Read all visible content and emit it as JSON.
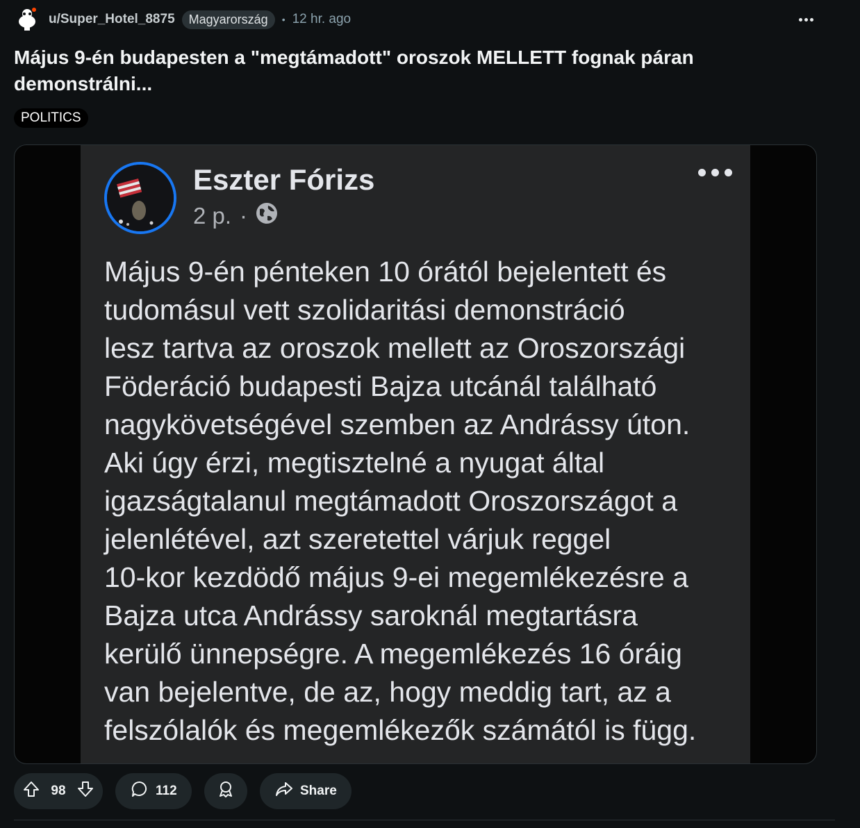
{
  "post": {
    "username": "u/Super_Hotel_8875",
    "subreddit_flair": "Magyarország",
    "separator": "•",
    "time": "12 hr. ago",
    "title": "Május 9-én budapesten a \"megtámadott\" oroszok MELLETT fognak páran demonstrálni...",
    "tag": "POLITICS"
  },
  "facebook_post": {
    "author": "Eszter Fórizs",
    "time": "2 p.",
    "dot": "·",
    "body": "Május 9-én pénteken 10 órától bejelentett és\ntudomásul vett szolidaritási demonstráció\nlesz tartva az oroszok mellett az Oroszországi\nFöderáció budapesti Bajza utcánál található\nnagykövetségével szemben az Andrássy úton.\nAki úgy érzi, megtisztelné a nyugat által\nigazságtalanul megtámadott Oroszországot a\njelenlétével, azt szeretettel várjuk reggel\n10-kor kezdödő május 9-ei megemlékezésre a\nBajza utca Andrássy saroknál megtartásra\nkerülő ünnepségre. A megemlékezés 16 óráig\nvan bejelentve, de az, hogy meddig tart, az a\nfelszólalók és megemlékezők számától is függ."
  },
  "actions": {
    "upvotes": "98",
    "comments": "112",
    "share_label": "Share"
  },
  "icons": [
    "reddit-avatar-icon",
    "more-icon",
    "globe-icon",
    "upvote-icon",
    "downvote-icon",
    "comment-icon",
    "award-icon",
    "share-icon"
  ],
  "colors": {
    "background": "#0e1113",
    "pill": "#1f2629",
    "facebook_card": "#242526",
    "facebook_blue": "#1877f2"
  }
}
